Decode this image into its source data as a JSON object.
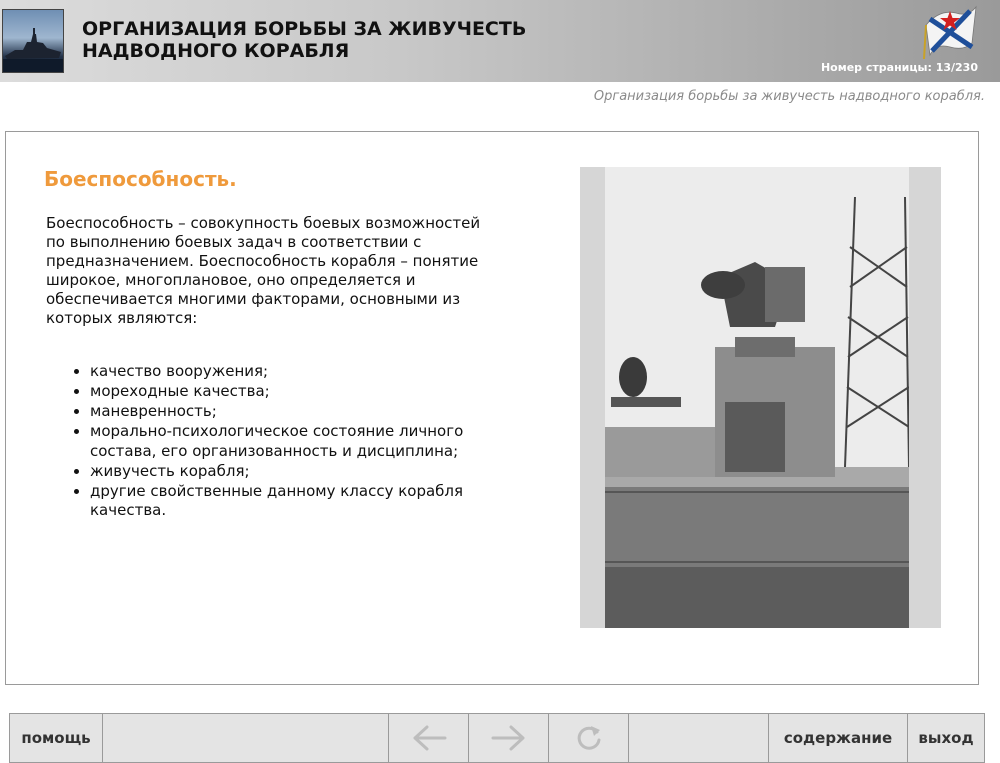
{
  "header": {
    "title": "ОРГАНИЗАЦИЯ БОРЬБЫ ЗА ЖИВУЧЕСТЬ\nНАДВОДНОГО КОРАБЛЯ",
    "page_counter": "Номер страницы: 13/230"
  },
  "subtitle": "Организация борьбы за живучесть надводного корабля.",
  "content": {
    "heading": "Боеспособность.",
    "paragraph": "Боеспособность – совокупность боевых возможностей по выполнению боевых задач в соответствии с предназначением. Боеспособность корабля – понятие широкое, многоплановое, оно определяется и обеспечивается многими факторами, основными из которых являются:",
    "bullets": [
      "качество вооружения;",
      "мореходные качества;",
      "маневренность;",
      "морально-психологическое состояние личного состава, его организованность и дисциплина;",
      "живучесть корабля;",
      "другие свойственные данному классу корабля качества."
    ]
  },
  "toolbar": {
    "help_label": "помощь",
    "contents_label": "содержание",
    "exit_label": "выход",
    "back_icon": "arrow-left-icon",
    "forward_icon": "arrow-right-icon",
    "reload_icon": "reload-icon"
  },
  "colors": {
    "heading_accent": "#ef9a3c",
    "toolbar_bg": "#e4e4e4",
    "icon_disabled": "#bdbdbd"
  }
}
